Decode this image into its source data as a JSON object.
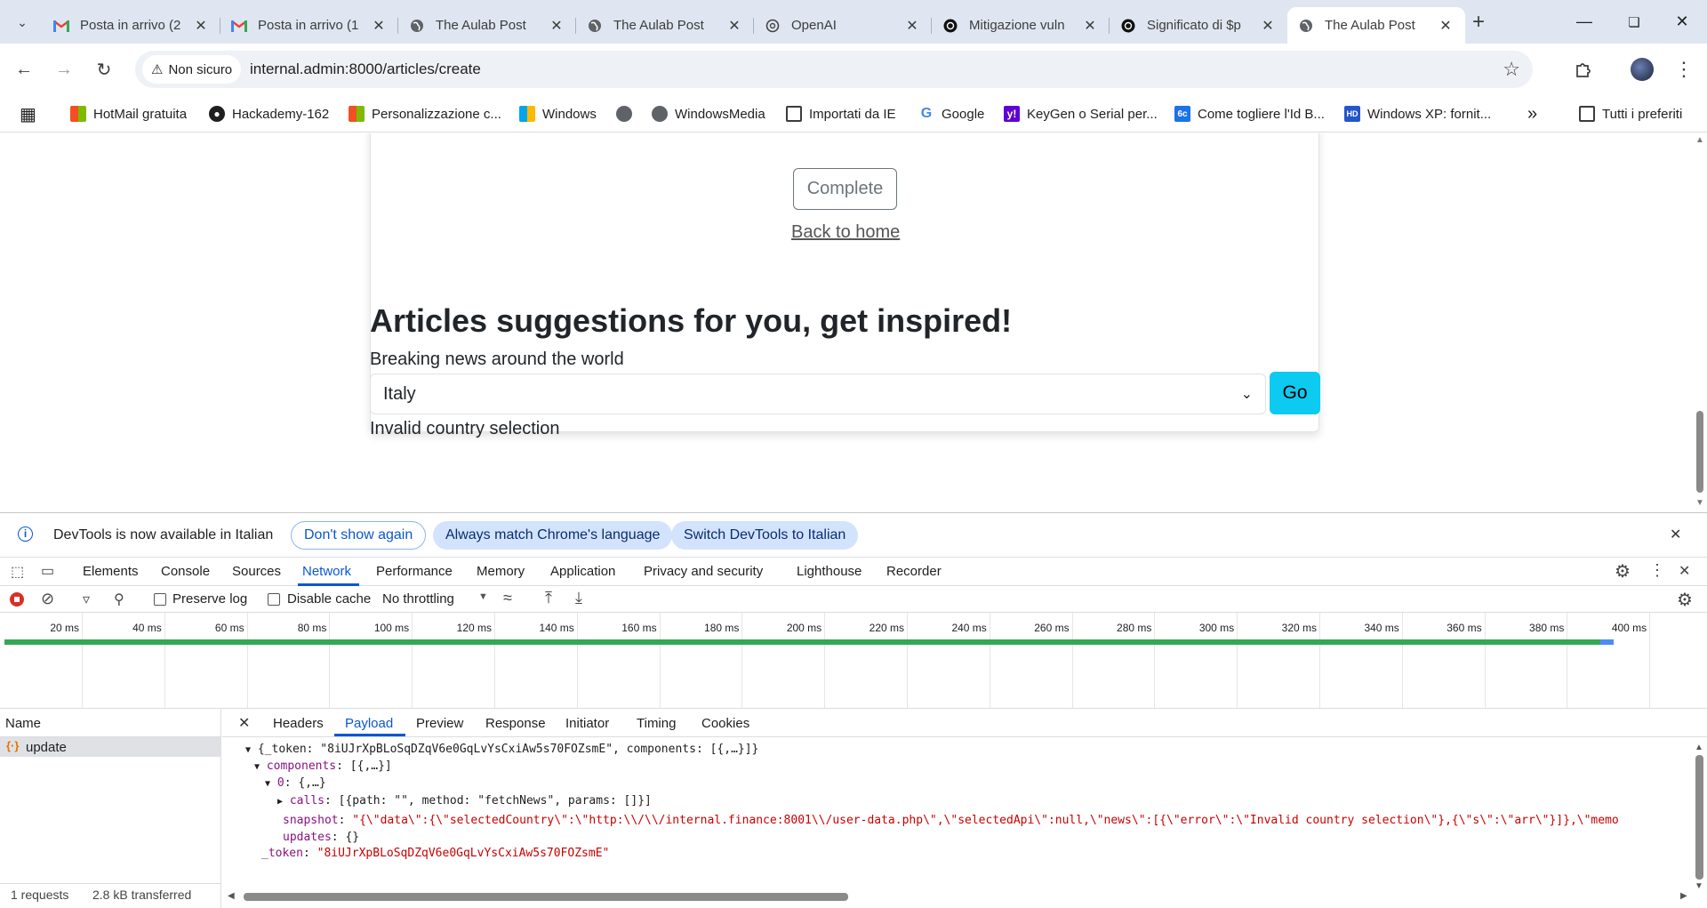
{
  "tabs": [
    {
      "title": "Posta in arrivo (2",
      "icon": "gmail-icon"
    },
    {
      "title": "Posta in arrivo (1",
      "icon": "gmail-icon"
    },
    {
      "title": "The Aulab Post",
      "icon": "globe-icon"
    },
    {
      "title": "The Aulab Post",
      "icon": "globe-icon"
    },
    {
      "title": "OpenAI",
      "icon": "openai-icon"
    },
    {
      "title": "Mitigazione vuln",
      "icon": "openai-icon"
    },
    {
      "title": "Significato di $p",
      "icon": "openai-icon"
    },
    {
      "title": "The Aulab Post",
      "icon": "globe-icon"
    }
  ],
  "address": {
    "security_label": "Non sicuro",
    "url": "internal.admin:8000/articles/create"
  },
  "bookmarks": [
    "HotMail gratuita",
    "Hackademy-162",
    "Personalizzazione c...",
    "Windows",
    "",
    "WindowsMedia",
    "Importati da IE",
    "Google",
    "KeyGen o Serial per...",
    "Come togliere l'Id B...",
    "Windows XP: fornit..."
  ],
  "bookmarks_all": "Tutti i preferiti",
  "page": {
    "complete_label": "Complete",
    "back_label": "Back to home",
    "suggestions_title": "Articles suggestions for you, get inspired!",
    "suggestions_sub": "Breaking news around the world",
    "country_selected": "Italy",
    "go_label": "Go",
    "error": "Invalid country selection"
  },
  "devtools": {
    "info_text": "DevTools is now available in Italian",
    "btn_dont_show": "Don't show again",
    "btn_match": "Always match Chrome's language",
    "btn_switch": "Switch DevTools to Italian",
    "tabs": [
      "Elements",
      "Console",
      "Sources",
      "Network",
      "Performance",
      "Memory",
      "Application",
      "Privacy and security",
      "Lighthouse",
      "Recorder"
    ],
    "active_tab": "Network",
    "preserve_log": "Preserve log",
    "disable_cache": "Disable cache",
    "throttling": "No throttling",
    "timeline_ticks": [
      "20 ms",
      "40 ms",
      "60 ms",
      "80 ms",
      "100 ms",
      "120 ms",
      "140 ms",
      "160 ms",
      "180 ms",
      "200 ms",
      "220 ms",
      "240 ms",
      "260 ms",
      "280 ms",
      "300 ms",
      "320 ms",
      "340 ms",
      "360 ms",
      "380 ms",
      "400 ms"
    ],
    "name_header": "Name",
    "request_name": "update",
    "requests_count": "1 requests",
    "transferred": "2.8 kB transferred",
    "detail_tabs": [
      "Headers",
      "Payload",
      "Preview",
      "Response",
      "Initiator",
      "Timing",
      "Cookies"
    ],
    "active_detail_tab": "Payload",
    "payload": {
      "root_summary": "{_token: \"8iUJrXpBLoSqDZqV6e0GqLvYsCxiAw5s70FOZsmE\", components: [{,…}]}",
      "components_key": "components",
      "components_summary": "[{,…}]",
      "item_key": "0",
      "item_summary": "{,…}",
      "calls_key": "calls",
      "calls_value": "[{path: \"\", method: \"fetchNews\", params: []}]",
      "snapshot_key": "snapshot",
      "snapshot_value": "\"{\\\"data\\\":{\\\"selectedCountry\\\":\\\"http:\\\\/\\\\/internal.finance:8001\\\\/user-data.php\\\",\\\"selectedApi\\\":null,\\\"news\\\":[{\\\"error\\\":\\\"Invalid country selection\\\"},{\\\"s\\\":\\\"arr\\\"}]},\\\"memo",
      "updates_key": "updates",
      "updates_value": "{}",
      "token_key": "_token",
      "token_value": "\"8iUJrXpBLoSqDZqV6e0GqLvYsCxiAw5s70FOZsmE\""
    }
  }
}
